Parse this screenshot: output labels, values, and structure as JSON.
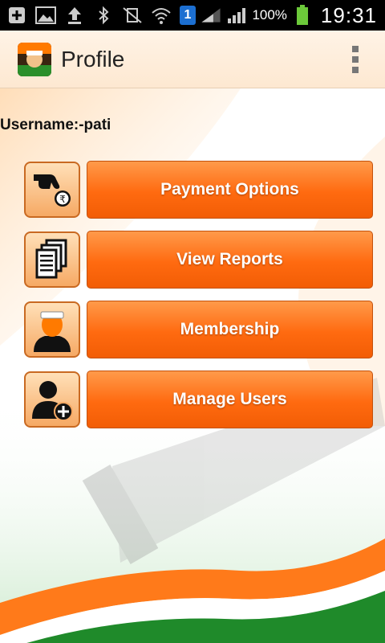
{
  "status_bar": {
    "battery_percent": "100%",
    "time": "19:31",
    "sim_slot": "1"
  },
  "action_bar": {
    "title": "Profile"
  },
  "profile": {
    "username_label": "Username:-pati"
  },
  "menu": [
    {
      "label": "Payment Options",
      "icon": "hand-coin-rupee-icon"
    },
    {
      "label": "View Reports",
      "icon": "documents-icon"
    },
    {
      "label": "Membership",
      "icon": "member-person-icon"
    },
    {
      "label": "Manage Users",
      "icon": "add-user-icon"
    }
  ],
  "colors": {
    "button_orange": "#ff6a10",
    "saffron": "#ff7a00",
    "green": "#2b8f2b"
  }
}
